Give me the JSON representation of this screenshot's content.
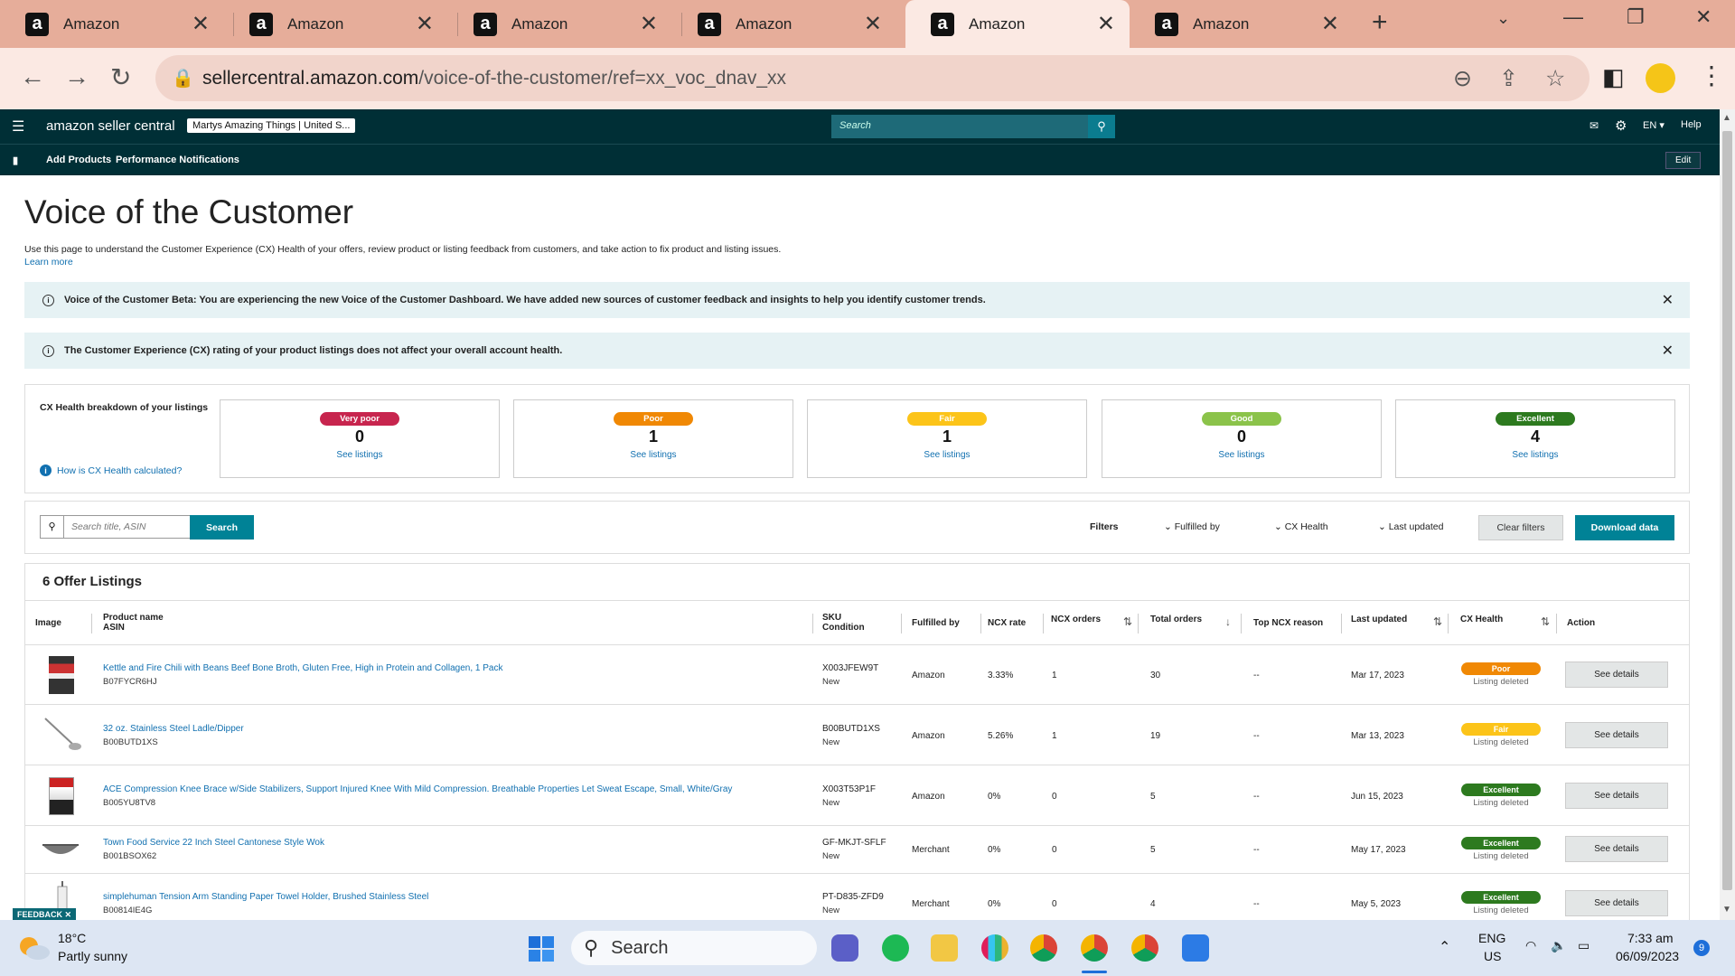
{
  "browser": {
    "tabs": [
      {
        "title": "Amazon"
      },
      {
        "title": "Amazon"
      },
      {
        "title": "Amazon"
      },
      {
        "title": "Amazon"
      },
      {
        "title": "Amazon"
      },
      {
        "title": "Amazon"
      }
    ],
    "active_tab_index": 4,
    "url_domain": "sellercentral.amazon.com",
    "url_path": "/voice-of-the-customer/ref=xx_voc_dnav_xx"
  },
  "header": {
    "logo": "amazon seller central",
    "store": "Martys Amazing Things | United S...",
    "search_placeholder": "Search",
    "lang": "EN",
    "help": "Help",
    "sub_links": [
      "Add Products",
      "Performance Notifications"
    ],
    "edit": "Edit"
  },
  "page": {
    "title": "Voice of the Customer",
    "intro": "Use this page to understand the Customer Experience (CX) Health of your offers, review product or listing feedback from customers, and take action to fix product and listing issues.",
    "learn_more": "Learn more",
    "banner1": "Voice of the Customer Beta: You are experiencing the new Voice of the Customer Dashboard. We have added new sources of customer feedback and insights to help you identify customer trends.",
    "banner2": "The Customer Experience (CX) rating of your product listings does not affect your overall account health."
  },
  "cx": {
    "title": "CX Health breakdown of your listings",
    "how": "How is CX Health calculated?",
    "see": "See listings",
    "cards": [
      {
        "label": "Very poor",
        "count": "0",
        "color": "#c7254e"
      },
      {
        "label": "Poor",
        "count": "1",
        "color": "#f08804"
      },
      {
        "label": "Fair",
        "count": "1",
        "color": "#fcc419"
      },
      {
        "label": "Good",
        "count": "0",
        "color": "#8bc34a"
      },
      {
        "label": "Excellent",
        "count": "4",
        "color": "#2d7a1f"
      }
    ]
  },
  "filters": {
    "search_placeholder": "Search title, ASIN",
    "search_btn": "Search",
    "filters_label": "Filters",
    "fulfilled_by": "Fulfilled by",
    "cx_health": "CX Health",
    "last_updated": "Last updated",
    "clear": "Clear filters",
    "download": "Download data"
  },
  "table": {
    "title": "6 Offer Listings",
    "headers": {
      "image": "Image",
      "product": "Product name",
      "asin": "ASIN",
      "sku": "SKU",
      "condition": "Condition",
      "fulfilled": "Fulfilled by",
      "ncx_rate": "NCX rate",
      "ncx_orders": "NCX orders",
      "total_orders": "Total orders",
      "top_reason": "Top NCX reason",
      "last_updated": "Last updated",
      "cx_health": "CX Health",
      "action": "Action"
    },
    "see_details": "See details",
    "rows": [
      {
        "name": "Kettle and Fire Chili with Beans Beef Bone Broth, Gluten Free, High in Protein and Collagen, 1 Pack",
        "asin": "B07FYCR6HJ",
        "sku": "X003JFEW9T",
        "cond": "New",
        "fulfilled": "Amazon",
        "rate": "3.33%",
        "ncx": "1",
        "total": "30",
        "reason": "--",
        "updated": "Mar 17, 2023",
        "health": "Poor",
        "health_color": "#f08804",
        "status": "Listing deleted"
      },
      {
        "name": "32 oz. Stainless Steel Ladle/Dipper",
        "asin": "B00BUTD1XS",
        "sku": "B00BUTD1XS",
        "cond": "New",
        "fulfilled": "Amazon",
        "rate": "5.26%",
        "ncx": "1",
        "total": "19",
        "reason": "--",
        "updated": "Mar 13, 2023",
        "health": "Fair",
        "health_color": "#fcc419",
        "status": "Listing deleted"
      },
      {
        "name": "ACE Compression Knee Brace w/Side Stabilizers, Support Injured Knee With Mild Compression. Breathable Properties Let Sweat Escape, Small, White/Gray",
        "asin": "B005YU8TV8",
        "sku": "X003T53P1F",
        "cond": "New",
        "fulfilled": "Amazon",
        "rate": "0%",
        "ncx": "0",
        "total": "5",
        "reason": "--",
        "updated": "Jun 15, 2023",
        "health": "Excellent",
        "health_color": "#2d7a1f",
        "status": "Listing deleted"
      },
      {
        "name": "Town Food Service 22 Inch Steel Cantonese Style Wok",
        "asin": "B001BSOX62",
        "sku": "GF-MKJT-SFLF",
        "cond": "New",
        "fulfilled": "Merchant",
        "rate": "0%",
        "ncx": "0",
        "total": "5",
        "reason": "--",
        "updated": "May 17, 2023",
        "health": "Excellent",
        "health_color": "#2d7a1f",
        "status": "Listing deleted"
      },
      {
        "name": "simplehuman Tension Arm Standing Paper Towel Holder, Brushed Stainless Steel",
        "asin": "B00814IE4G",
        "sku": "PT-D835-ZFD9",
        "cond": "New",
        "fulfilled": "Merchant",
        "rate": "0%",
        "ncx": "0",
        "total": "4",
        "reason": "--",
        "updated": "May 5, 2023",
        "health": "Excellent",
        "health_color": "#2d7a1f",
        "status": "Listing deleted"
      }
    ]
  },
  "feedback": "FEEDBACK",
  "taskbar": {
    "temp": "18°C",
    "weather": "Partly sunny",
    "search": "Search",
    "lang1": "ENG",
    "lang2": "US",
    "time": "7:33 am",
    "date": "06/09/2023",
    "badge": "9"
  }
}
